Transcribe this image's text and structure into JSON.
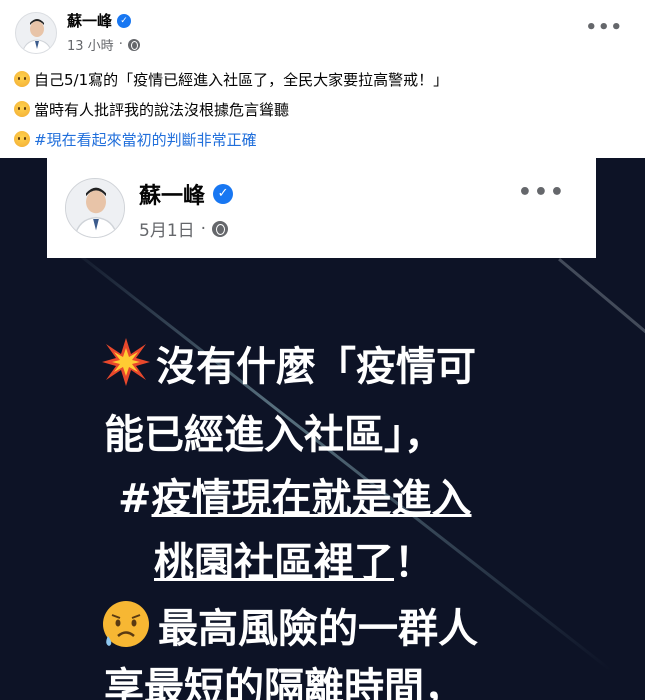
{
  "post": {
    "author": "蘇一峰",
    "time": "13 小時",
    "separator": "·",
    "more_label": "•••",
    "lines": [
      {
        "emoji": "weary-face-emoji",
        "text": "自己5/1寫的「疫情已經進入社區了，全民大家要拉高警戒！」"
      },
      {
        "emoji": "unamused-face-emoji",
        "text": "當時有人批評我的說法沒根據危言聳聽"
      },
      {
        "emoji": "weary-face-emoji",
        "text": "#現在看起來當初的判斷非常正確"
      }
    ]
  },
  "shared_image": {
    "author": "蘇一峰",
    "date": "5月1日",
    "separator": "·",
    "more_label": "•••",
    "lines": {
      "l1": "沒有什麼「疫情可",
      "l2": "能已經進入社區」，",
      "l3_hash": "#",
      "l3_underlined": "疫情現在就是進入",
      "l4_underlined": "桃園社區裡了",
      "l4_tail": "！",
      "l5": "最高風險的一群人",
      "l6": "享最短的隔離時間，"
    }
  },
  "colors": {
    "verified": "#1877f2",
    "hashtag": "#216fdb",
    "image_background": "#0d1326",
    "secondary_text": "#65676b"
  }
}
